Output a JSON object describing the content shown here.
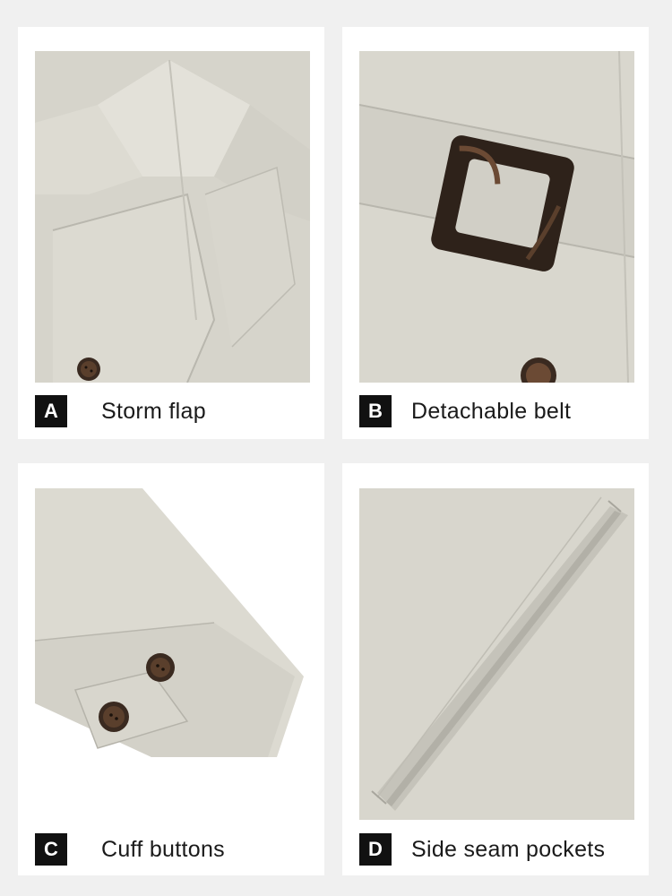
{
  "colors": {
    "page_background": "#f0f0f0",
    "card_background": "#ffffff",
    "fabric": "#d9d7ce",
    "badge_background": "#111111",
    "badge_text": "#ffffff",
    "tortoiseshell": "#3a2a20"
  },
  "panels": [
    {
      "letter": "A",
      "label": "Storm flap",
      "image": "storm-flap-photo"
    },
    {
      "letter": "B",
      "label": "Detachable belt",
      "image": "belt-buckle-photo"
    },
    {
      "letter": "C",
      "label": "Cuff buttons",
      "image": "cuff-buttons-photo"
    },
    {
      "letter": "D",
      "label": "Side seam pockets",
      "image": "side-pocket-photo"
    }
  ]
}
